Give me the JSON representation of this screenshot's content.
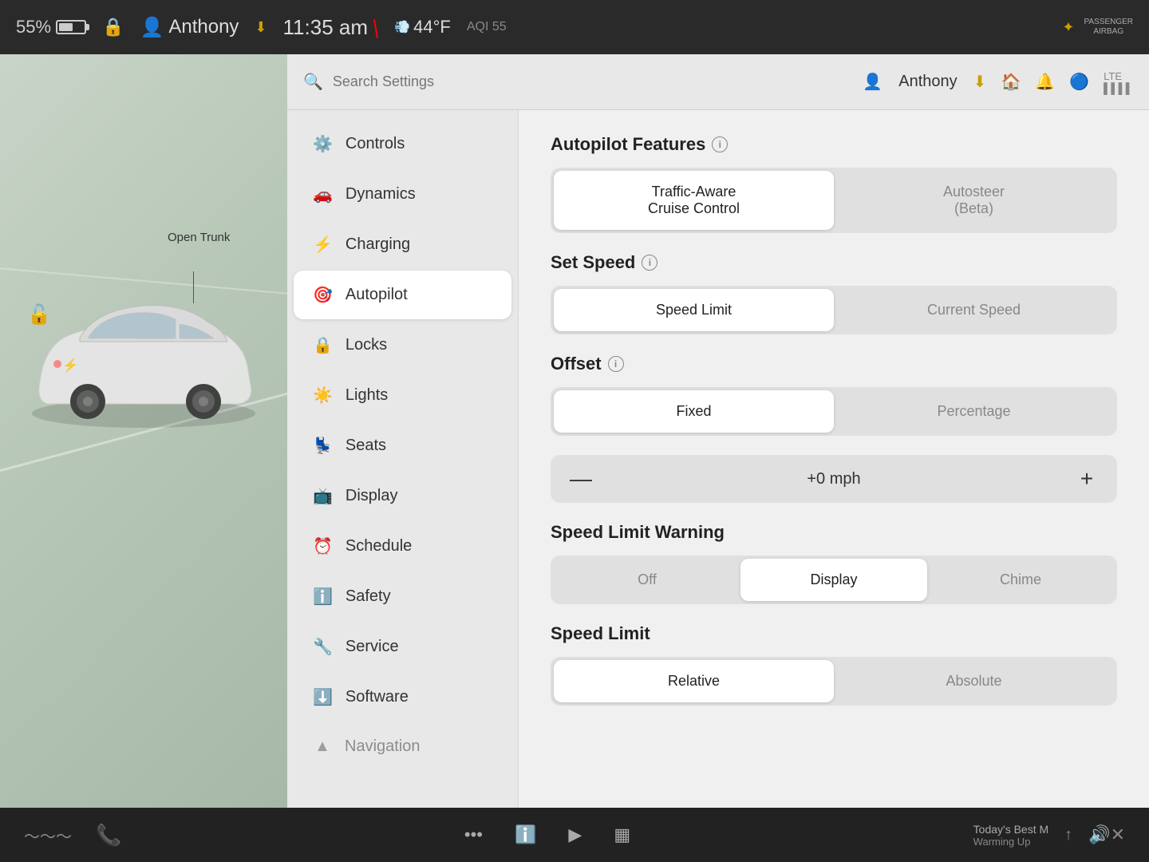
{
  "statusBar": {
    "battery": "55%",
    "user": "Anthony",
    "time": "11:35 am",
    "temperature": "44°F",
    "aqi": "AQI 55",
    "passengerAirbag": "PASSENGER\nAIRBAG"
  },
  "search": {
    "placeholder": "Search Settings"
  },
  "header": {
    "user": "Anthony",
    "icons": [
      "download",
      "home",
      "bell",
      "bluetooth",
      "lte"
    ]
  },
  "nav": {
    "items": [
      {
        "id": "controls",
        "label": "Controls",
        "icon": "⚙"
      },
      {
        "id": "dynamics",
        "label": "Dynamics",
        "icon": "🚗"
      },
      {
        "id": "charging",
        "label": "Charging",
        "icon": "⚡"
      },
      {
        "id": "autopilot",
        "label": "Autopilot",
        "icon": "🎯",
        "active": true
      },
      {
        "id": "locks",
        "label": "Locks",
        "icon": "🔒"
      },
      {
        "id": "lights",
        "label": "Lights",
        "icon": "☀"
      },
      {
        "id": "seats",
        "label": "Seats",
        "icon": "💺"
      },
      {
        "id": "display",
        "label": "Display",
        "icon": "📺"
      },
      {
        "id": "schedule",
        "label": "Schedule",
        "icon": "⏰"
      },
      {
        "id": "safety",
        "label": "Safety",
        "icon": "ℹ"
      },
      {
        "id": "service",
        "label": "Service",
        "icon": "🔧"
      },
      {
        "id": "software",
        "label": "Software",
        "icon": "⬇"
      },
      {
        "id": "navigation",
        "label": "Navigation",
        "icon": "▲"
      }
    ]
  },
  "autopilot": {
    "featuresSectionTitle": "Autopilot Features",
    "features": [
      {
        "label": "Traffic-Aware\nCruise Control",
        "active": true
      },
      {
        "label": "Autosteer\n(Beta)",
        "active": false
      }
    ],
    "setSpeedSectionTitle": "Set Speed",
    "setSpeedOptions": [
      {
        "label": "Speed Limit",
        "active": true
      },
      {
        "label": "Current Speed",
        "active": false
      }
    ],
    "offsetSectionTitle": "Offset",
    "offsetOptions": [
      {
        "label": "Fixed",
        "active": true
      },
      {
        "label": "Percentage",
        "active": false
      }
    ],
    "speedValue": "+0 mph",
    "speedLimitWarningSectionTitle": "Speed Limit Warning",
    "speedLimitWarningOptions": [
      {
        "label": "Off",
        "active": false
      },
      {
        "label": "Display",
        "active": true
      },
      {
        "label": "Chime",
        "active": false
      }
    ],
    "speedLimitSectionTitle": "Speed Limit",
    "speedLimitOptions": [
      {
        "label": "Relative",
        "active": true
      },
      {
        "label": "Absolute",
        "active": false
      }
    ]
  },
  "openTrunk": "Open\nTrunk",
  "taskbar": {
    "mediaTitle": "Today's Best M",
    "mediaStatus": "Warming Up",
    "volumeIcon": "🔊"
  }
}
